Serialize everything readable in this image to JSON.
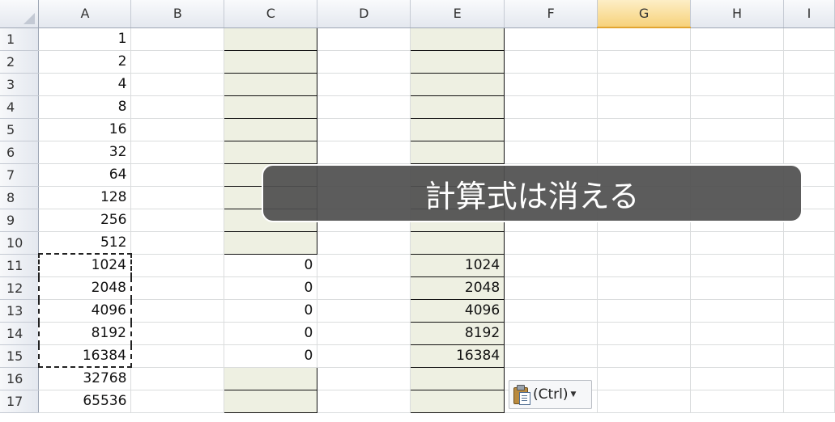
{
  "columns": [
    "A",
    "B",
    "C",
    "D",
    "E",
    "F",
    "G",
    "H",
    "I"
  ],
  "selected_column": "G",
  "rows": [
    {
      "num": "1",
      "a": "1",
      "c": "",
      "e": ""
    },
    {
      "num": "2",
      "a": "2",
      "c": "",
      "e": ""
    },
    {
      "num": "3",
      "a": "4",
      "c": "",
      "e": ""
    },
    {
      "num": "4",
      "a": "8",
      "c": "",
      "e": ""
    },
    {
      "num": "5",
      "a": "16",
      "c": "",
      "e": ""
    },
    {
      "num": "6",
      "a": "32",
      "c": "",
      "e": ""
    },
    {
      "num": "7",
      "a": "64",
      "c": "",
      "e": ""
    },
    {
      "num": "8",
      "a": "128",
      "c": "",
      "e": ""
    },
    {
      "num": "9",
      "a": "256",
      "c": "",
      "e": ""
    },
    {
      "num": "10",
      "a": "512",
      "c": "",
      "e": ""
    },
    {
      "num": "11",
      "a": "1024",
      "c": "0",
      "e": "1024"
    },
    {
      "num": "12",
      "a": "2048",
      "c": "0",
      "e": "2048"
    },
    {
      "num": "13",
      "a": "4096",
      "c": "0",
      "e": "4096"
    },
    {
      "num": "14",
      "a": "8192",
      "c": "0",
      "e": "8192"
    },
    {
      "num": "15",
      "a": "16384",
      "c": "0",
      "e": "16384"
    },
    {
      "num": "16",
      "a": "32768",
      "c": "",
      "e": ""
    },
    {
      "num": "17",
      "a": "65536",
      "c": "",
      "e": ""
    }
  ],
  "caption": "計算式は消える",
  "paste_options": {
    "label": "(Ctrl)",
    "icon": "clipboard-paste-icon"
  },
  "colors": {
    "shaded_fill": "#eef0e2",
    "selected_header": "#f7d27b",
    "caption_bg": "#505050"
  }
}
